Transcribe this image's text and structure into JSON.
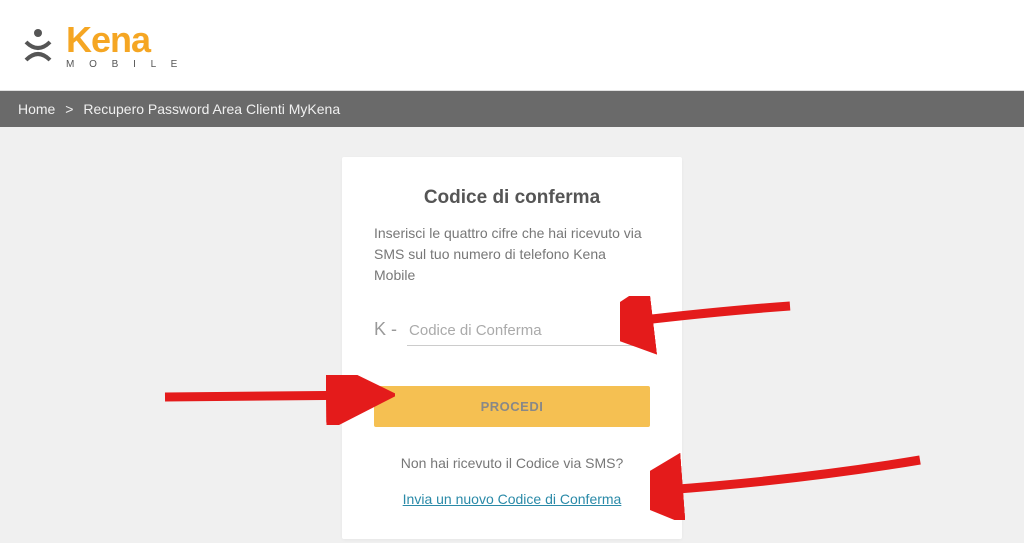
{
  "logo": {
    "main": "Kena",
    "sub": "M O B I L E"
  },
  "breadcrumb": {
    "home": "Home",
    "separator": ">",
    "current": "Recupero Password Area Clienti MyKena"
  },
  "card": {
    "title": "Codice di conferma",
    "description": "Inserisci le quattro cifre che hai ricevuto via SMS sul tuo numero di telefono Kena Mobile",
    "input_prefix": "K -",
    "input_placeholder": "Codice di Conferma",
    "proceed_label": "PROCEDI",
    "not_received_text": "Non hai ricevuto il Codice via SMS?",
    "resend_link_text": "Invia un nuovo Codice di Conferma"
  },
  "colors": {
    "brand": "#f5a623",
    "button": "#f5c052",
    "link": "#2a8aa8",
    "arrow": "#e41b1b"
  }
}
